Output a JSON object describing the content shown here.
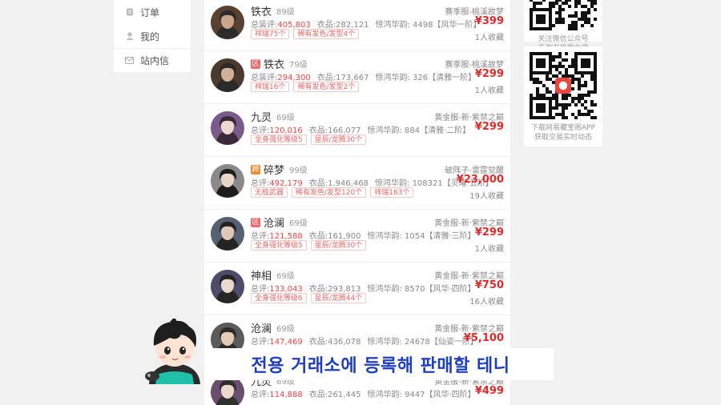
{
  "menu": {
    "items": [
      {
        "label": "订单",
        "icon": "order-icon"
      },
      {
        "label": "我的",
        "icon": "user-icon"
      },
      {
        "label": "站内信",
        "icon": "mail-icon"
      }
    ]
  },
  "listings": [
    {
      "name": "铁衣",
      "tag": "",
      "level": "89级",
      "server": "赛季服-桃溪故梦",
      "score_label": "总装评:",
      "score": "405,803",
      "outfit_label": "衣品:",
      "outfit": "282,121",
      "jinghong": "惊鸿华韵: 4498【风华一阶】",
      "price": "¥399",
      "favs": "1人收藏",
      "pills": [
        "祥瑞75个",
        "稀有发色/发型4个"
      ]
    },
    {
      "name": "铁衣",
      "tag": "区",
      "level": "79级",
      "server": "赛季服-桃溪故梦",
      "score_label": "总装评:",
      "score": "294,300",
      "outfit_label": "衣品:",
      "outfit": "173,667",
      "jinghong": "惊鸿华韵: 326【清雅一阶】",
      "price": "¥299",
      "favs": "1人收藏",
      "pills": [
        "祥瑞16个",
        "稀有发色/发型2个"
      ]
    },
    {
      "name": "九灵",
      "tag": "",
      "level": "69级",
      "server": "黄金服-新·紫禁之巅",
      "score_label": "总评:",
      "score": "120,016",
      "outfit_label": "衣品:",
      "outfit": "166,077",
      "jinghong": "惊鸿华韵: 884【清雅·二阶】",
      "price": "¥299",
      "favs": "",
      "pills": [
        "全身强化等级5",
        "星辰/龙腾30个"
      ]
    },
    {
      "name": "碎梦",
      "tag": "跨",
      "level": "99级",
      "server": "破阵子-雷霆觉醒",
      "score_label": "总评:",
      "score": "492,179",
      "outfit_label": "衣品:",
      "outfit": "1,946,468",
      "jinghong": "惊鸿华韵: 108321【灵曜·五阶】",
      "price": "¥23,000",
      "favs": "19人收藏",
      "pills": [
        "无极武器",
        "稀有发色/发型120个",
        "祥瑞163个"
      ]
    },
    {
      "name": "沧澜",
      "tag": "区",
      "level": "69级",
      "server": "黄金服-新·紫禁之巅",
      "score_label": "总评:",
      "score": "121,588",
      "outfit_label": "衣品:",
      "outfit": "161,900",
      "jinghong": "惊鸿华韵: 1054【清雅·三阶】",
      "price": "¥299",
      "favs": "1人收藏",
      "pills": [
        "全身强化等级5",
        "星辰/龙腾30个"
      ]
    },
    {
      "name": "神相",
      "tag": "",
      "level": "69级",
      "server": "黄金服-新·紫禁之巅",
      "score_label": "总评:",
      "score": "133,043",
      "outfit_label": "衣品:",
      "outfit": "293,813",
      "jinghong": "惊鸿华韵: 8570【风华·四阶】",
      "price": "¥750",
      "favs": "16人收藏",
      "pills": [
        "全身强化等级6",
        "星辰/龙腾44个"
      ]
    },
    {
      "name": "沧澜",
      "tag": "",
      "level": "69级",
      "server": "黄金服-新·紫禁之巅",
      "score_label": "总评:",
      "score": "147,469",
      "outfit_label": "衣品:",
      "outfit": "436,078",
      "jinghong": "惊鸿华韵: 24678【仙姿一阶】",
      "price": "¥5,100",
      "favs": "",
      "pills": []
    },
    {
      "name": "九灵",
      "tag": "",
      "level": "69级",
      "server": "黄金服-新·紫禁之巅",
      "score_label": "总评:",
      "score": "114,888",
      "outfit_label": "衣品:",
      "outfit": "261,445",
      "jinghong": "惊鸿华韵: 9447【风华·四阶】",
      "price": "¥499",
      "favs": "",
      "pills": []
    }
  ],
  "qr": {
    "wechat_caption_1": "关注微信公众号",
    "wechat_caption_2": "手游交易更方便",
    "app_caption_1": "下载网易藏宝阁APP",
    "app_caption_2": "获取交易实时动态"
  },
  "subtitle": "전용 거래소에 등록해 판매할 테니",
  "colors": {
    "price": "#e02a2a",
    "score": "#e94545",
    "subtitle": "#1e3ec2",
    "tag": "#ec6b6b"
  }
}
